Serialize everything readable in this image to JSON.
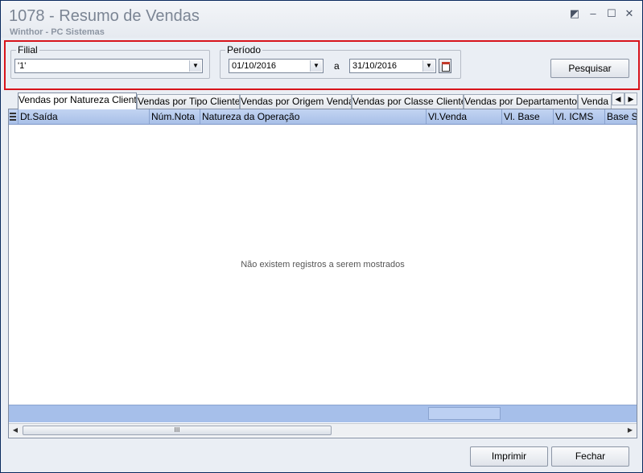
{
  "window": {
    "title": "1078 - Resumo de Vendas",
    "subtitle": "Winthor - PC Sistemas",
    "controls": {
      "restore": "◩",
      "minimize": "–",
      "maximize": "☐",
      "close": "✕"
    }
  },
  "filters": {
    "filial": {
      "label": "Filial",
      "value": "'1'"
    },
    "periodo": {
      "label": "Período",
      "start": "01/10/2016",
      "separator": "a",
      "end": "31/10/2016"
    },
    "search_button": "Pesquisar"
  },
  "tabs": [
    {
      "label": "Vendas por Natureza Cliente",
      "active": true
    },
    {
      "label": "Vendas por Tipo Cliente"
    },
    {
      "label": "Vendas por Origem Venda"
    },
    {
      "label": "Vendas por Classe Cliente"
    },
    {
      "label": "Vendas por Departamento"
    },
    {
      "label": "Venda"
    }
  ],
  "grid": {
    "columns": [
      "Dt.Saída",
      "Núm.Nota",
      "Natureza da Operação",
      "Vl.Venda",
      "Vl. Base",
      "Vl. ICMS",
      "Base ST"
    ],
    "empty_message": "Não existem registros a serem mostrados"
  },
  "buttons": {
    "print": "Imprimir",
    "close": "Fechar"
  }
}
